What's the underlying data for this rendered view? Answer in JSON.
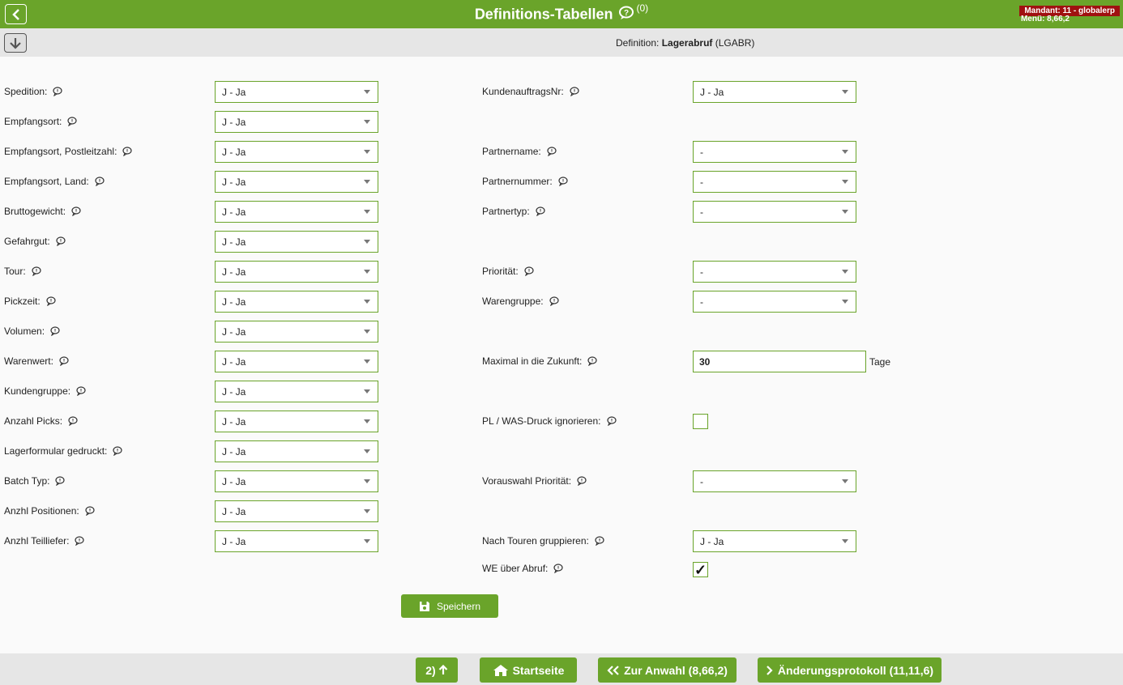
{
  "header": {
    "title": "Definitions-Tabellen",
    "count": "(0)",
    "mandant": "Mandant: 11 - globalerp",
    "menu": "Menü: 8,66,2"
  },
  "subheader": {
    "definition_prefix": "Definition:",
    "definition_name": "Lagerabruf",
    "definition_code": "(LGABR)"
  },
  "left_fields": [
    {
      "label": "Spedition:",
      "value": "J - Ja"
    },
    {
      "label": "Empfangsort:",
      "value": "J - Ja"
    },
    {
      "label": "Empfangsort, Postleitzahl:",
      "value": "J - Ja"
    },
    {
      "label": "Empfangsort, Land:",
      "value": "J - Ja"
    },
    {
      "label": "Bruttogewicht:",
      "value": "J - Ja"
    },
    {
      "label": "Gefahrgut:",
      "value": "J - Ja"
    },
    {
      "label": "Tour:",
      "value": "J - Ja"
    },
    {
      "label": "Pickzeit:",
      "value": "J - Ja"
    },
    {
      "label": "Volumen:",
      "value": "J - Ja"
    },
    {
      "label": "Warenwert:",
      "value": "J - Ja"
    },
    {
      "label": "Kundengruppe:",
      "value": "J - Ja"
    },
    {
      "label": "Anzahl Picks:",
      "value": "J - Ja"
    },
    {
      "label": "Lagerformular gedruckt:",
      "value": "J - Ja"
    },
    {
      "label": "Batch Typ:",
      "value": "J - Ja"
    },
    {
      "label": "Anzhl Positionen:",
      "value": "J - Ja"
    },
    {
      "label": "Anzhl Teilliefer:",
      "value": "J - Ja"
    }
  ],
  "right_fields": {
    "kundenauftragsnr": {
      "label": "KundenauftragsNr:",
      "value": "J - Ja"
    },
    "partnername": {
      "label": "Partnername:",
      "value": "-"
    },
    "partnernummer": {
      "label": "Partnernummer:",
      "value": "-"
    },
    "partnertyp": {
      "label": "Partnertyp:",
      "value": "-"
    },
    "prioritaet": {
      "label": "Priorität:",
      "value": "-"
    },
    "warengruppe": {
      "label": "Warengruppe:",
      "value": "-"
    },
    "maximal": {
      "label": "Maximal in die Zukunft:",
      "value": "30",
      "unit": "Tage"
    },
    "pl_was": {
      "label": "PL / WAS-Druck ignorieren:",
      "checked": false
    },
    "vorauswahl": {
      "label": "Vorauswahl Priorität:",
      "value": "-"
    },
    "nach_touren": {
      "label": "Nach Touren gruppieren:",
      "value": "J - Ja"
    },
    "we_abruf": {
      "label": "WE über Abruf:",
      "checked": true,
      "check_mark": "✓"
    }
  },
  "buttons": {
    "save": "Speichern",
    "footer_up": "2)",
    "footer_home": "Startseite",
    "footer_select": "Zur Anwahl (8,66,2)",
    "footer_log": "Änderungsprotokoll (11,11,6)"
  },
  "colors": {
    "accent": "#6aa42a",
    "mandant_bg": "#a01010"
  }
}
